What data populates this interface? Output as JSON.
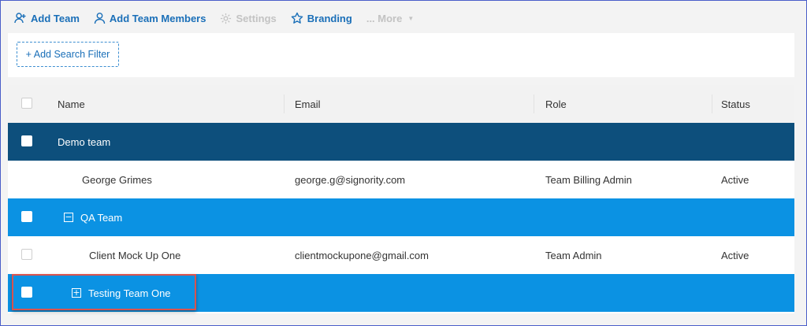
{
  "toolbar": {
    "add_team": "Add Team",
    "add_team_members": "Add Team Members",
    "settings": "Settings",
    "branding": "Branding",
    "more": "... More"
  },
  "filter": {
    "add_search_filter": "+ Add Search Filter"
  },
  "table": {
    "columns": {
      "name": "Name",
      "email": "Email",
      "role": "Role",
      "status": "Status"
    },
    "rows": [
      {
        "type": "team",
        "name": "Demo team"
      },
      {
        "type": "member",
        "name": "George Grimes",
        "email": "george.g@signority.com",
        "role": "Team Billing Admin",
        "status": "Active"
      },
      {
        "type": "subteam",
        "toggle": "−",
        "name": "QA Team"
      },
      {
        "type": "member",
        "name": "Client Mock Up One",
        "email": "clientmockupone@gmail.com",
        "role": "Team Admin",
        "status": "Active"
      },
      {
        "type": "subteam",
        "toggle": "+",
        "name": "Testing Team One"
      }
    ]
  },
  "colors": {
    "link": "#1a6fb8",
    "team_row": "#0d4f7c",
    "subteam_row": "#0b92e3",
    "highlight": "#d9534f"
  }
}
